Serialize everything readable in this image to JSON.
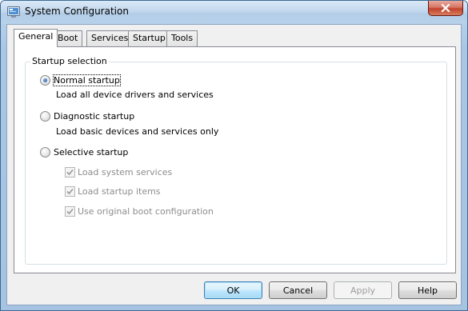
{
  "window": {
    "title": "System Configuration"
  },
  "tabs": [
    {
      "label": "General",
      "active": true
    },
    {
      "label": "Boot",
      "active": false
    },
    {
      "label": "Services",
      "active": false
    },
    {
      "label": "Startup",
      "active": false
    },
    {
      "label": "Tools",
      "active": false
    }
  ],
  "general": {
    "group_label": "Startup selection",
    "normal": {
      "label": "Normal startup",
      "description": "Load all device drivers and services",
      "selected": true
    },
    "diagnostic": {
      "label": "Diagnostic startup",
      "description": "Load basic devices and services only",
      "selected": false
    },
    "selective": {
      "label": "Selective startup",
      "selected": false,
      "options": [
        {
          "label": "Load system services",
          "checked": true,
          "enabled": false
        },
        {
          "label": "Load startup items",
          "checked": true,
          "enabled": false
        },
        {
          "label": "Use original boot configuration",
          "checked": true,
          "enabled": false
        }
      ]
    }
  },
  "buttons": {
    "ok": "OK",
    "cancel": "Cancel",
    "apply": "Apply",
    "help": "Help"
  },
  "icons": {
    "app": "system-configuration-icon",
    "close": "close-icon",
    "radio_dot": "radio-selected-dot",
    "check": "checkmark-icon"
  },
  "colors": {
    "title_bar": "#c3d8ee",
    "close_button": "#c2422c",
    "default_button_border": "#3c7fb1",
    "disabled_text": "#8d8d8d"
  }
}
